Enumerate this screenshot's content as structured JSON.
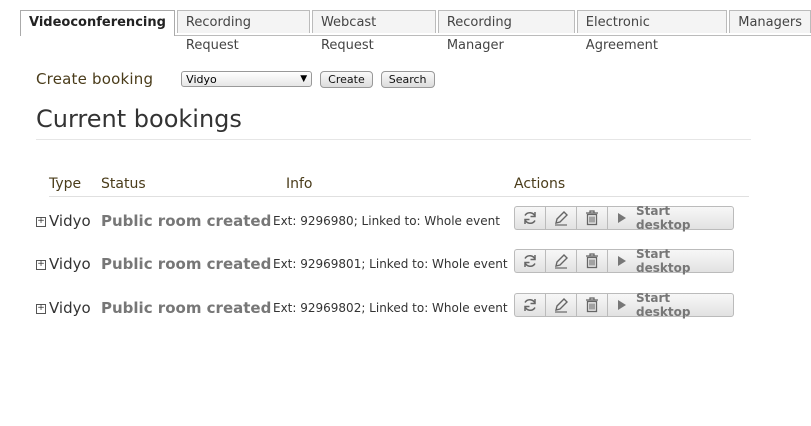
{
  "tabs": [
    {
      "label": "Videoconferencing",
      "active": true
    },
    {
      "label": "Recording Request"
    },
    {
      "label": "Webcast Request"
    },
    {
      "label": "Recording Manager"
    },
    {
      "label": "Electronic Agreement"
    },
    {
      "label": "Managers"
    }
  ],
  "create": {
    "label": "Create booking",
    "selected": "Vidyo",
    "create_btn": "Create",
    "search_btn": "Search"
  },
  "section_title": "Current bookings",
  "columns": {
    "type": "Type",
    "status": "Status",
    "info": "Info",
    "actions": "Actions"
  },
  "bookings": [
    {
      "type": "Vidyo",
      "status": "Public room created",
      "info": "Ext: 9296980; Linked to: Whole event",
      "start": "Start desktop"
    },
    {
      "type": "Vidyo",
      "status": "Public room created",
      "info": "Ext: 92969801; Linked to: Whole event",
      "start": "Start desktop"
    },
    {
      "type": "Vidyo",
      "status": "Public room created",
      "info": "Ext: 92969802; Linked to: Whole event",
      "start": "Start desktop"
    }
  ],
  "icons": {
    "expand": "plus-box-icon",
    "refresh": "refresh-icon",
    "edit": "pencil-icon",
    "delete": "trash-icon",
    "start": "play-icon"
  }
}
